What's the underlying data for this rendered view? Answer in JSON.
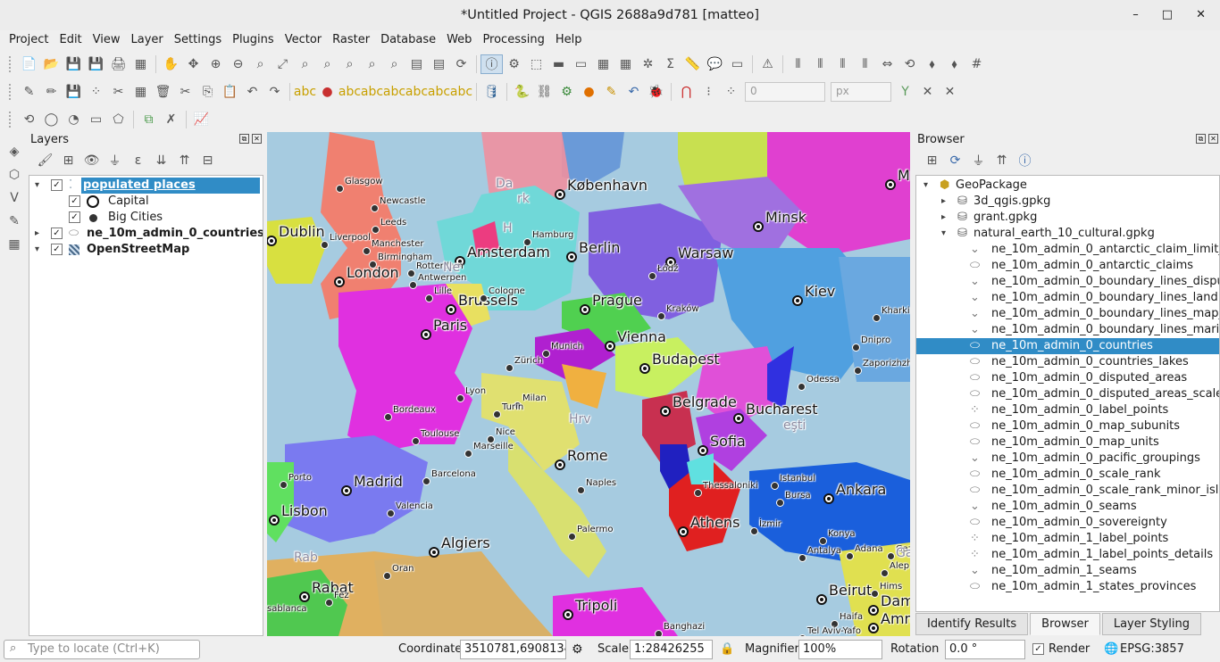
{
  "window": {
    "title": "*Untitled Project - QGIS 2688a9d781 [matteo]",
    "minimize": "–",
    "maximize": "□",
    "close": "✕"
  },
  "menu": [
    "Project",
    "Edit",
    "View",
    "Layer",
    "Settings",
    "Plugins",
    "Vector",
    "Raster",
    "Database",
    "Web",
    "Processing",
    "Help"
  ],
  "toolbar": {
    "snap_value": "0",
    "unit": "px"
  },
  "layers_panel": {
    "title": "Layers",
    "items": [
      {
        "label": "populated places"
      },
      {
        "label": "Capital"
      },
      {
        "label": "Big Cities"
      },
      {
        "label": "ne_10m_admin_0_countries"
      },
      {
        "label": "OpenStreetMap"
      }
    ]
  },
  "browser_panel": {
    "title": "Browser",
    "items": [
      "GeoPackage",
      "3d_qgis.gpkg",
      "grant.gpkg",
      "natural_earth_10_cultural.gpkg",
      "ne_10m_admin_0_antarctic_claim_limit_",
      "ne_10m_admin_0_antarctic_claims",
      "ne_10m_admin_0_boundary_lines_dispu",
      "ne_10m_admin_0_boundary_lines_land",
      "ne_10m_admin_0_boundary_lines_map_",
      "ne_10m_admin_0_boundary_lines_marit",
      "ne_10m_admin_0_countries",
      "ne_10m_admin_0_countries_lakes",
      "ne_10m_admin_0_disputed_areas",
      "ne_10m_admin_0_disputed_areas_scale",
      "ne_10m_admin_0_label_points",
      "ne_10m_admin_0_map_subunits",
      "ne_10m_admin_0_map_units",
      "ne_10m_admin_0_pacific_groupings",
      "ne_10m_admin_0_scale_rank",
      "ne_10m_admin_0_scale_rank_minor_isla",
      "ne_10m_admin_0_seams",
      "ne_10m_admin_0_sovereignty",
      "ne_10m_admin_1_label_points",
      "ne_10m_admin_1_label_points_details",
      "ne_10m_admin_1_seams",
      "ne_10m_admin_1_states_provinces"
    ]
  },
  "map": {
    "capitals": [
      "København",
      "Dublin",
      "London",
      "Amsterdam",
      "Berlin",
      "Warsaw",
      "Minsk",
      "Brussels",
      "Prague",
      "Kiev",
      "Paris",
      "Vienna",
      "Budapest",
      "Belgrade",
      "Bucharest",
      "Sofia",
      "Rome",
      "Madrid",
      "Lisbon",
      "Algiers",
      "Athens",
      "Ankara",
      "Rabat",
      "Tripoli",
      "Beirut",
      "Dam",
      "Amm",
      "M"
    ],
    "cities": [
      "Glasgow",
      "Newcastle",
      "Leeds",
      "Liverpool",
      "Manchester",
      "Birmingham",
      "Hamburg",
      "Łódź",
      "Rotterdam",
      "Antwerpen",
      "Lille",
      "Cologne",
      "Kraków",
      "Kharkiv",
      "Munich",
      "Zürich",
      "Dnipro",
      "Zaporizhzhya",
      "Odessa",
      "Lyon",
      "Milan",
      "Turin",
      "Bordeaux",
      "Toulouse",
      "Marseille",
      "Nice",
      "Barcelona",
      "Naples",
      "Porto",
      "Valencia",
      "Thessaloniki",
      "Istanbul",
      "Bursa",
      "İzmir",
      "Konya",
      "Antalya",
      "Adana",
      "Gaz",
      "Alep",
      "Hims",
      "Palermo",
      "Oran",
      "Fez",
      "Haifa",
      "Tel Aviv-Yafo",
      "Banghazi",
      "sablanca"
    ],
    "faint": [
      "Da",
      "rk",
      "H",
      "Ne",
      "Hrv",
      "eşti",
      "Rab",
      "Gaz"
    ]
  },
  "tabs": [
    "Identify Results",
    "Browser",
    "Layer Styling"
  ],
  "status": {
    "locate_placeholder": "Type to locate (Ctrl+K)",
    "coordinate_label": "Coordinate",
    "coordinate": "3510781,6908134",
    "scale_label": "Scale",
    "scale": "1:28426255",
    "magnifier_label": "Magnifier",
    "magnifier": "100%",
    "rotation_label": "Rotation",
    "rotation": "0.0 °",
    "render_label": "Render",
    "crs": "EPSG:3857"
  }
}
